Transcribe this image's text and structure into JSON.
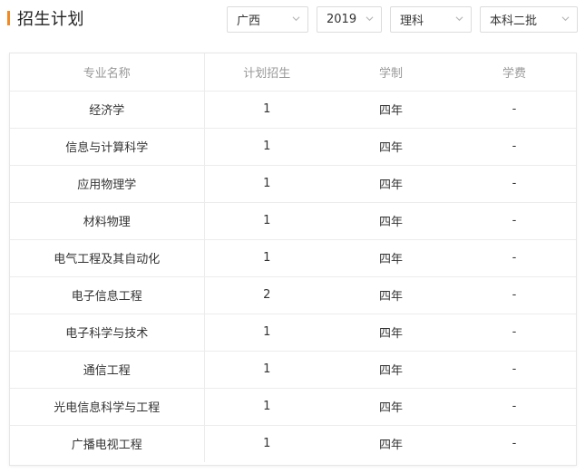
{
  "header": {
    "title": "招生计划"
  },
  "filters": {
    "province": "广西",
    "year": "2019",
    "subject": "理科",
    "batch": "本科二批"
  },
  "colors": {
    "accent": "#f08a24",
    "header_text": "#999999",
    "border": "#ececec"
  },
  "table": {
    "columns": [
      "专业名称",
      "计划招生",
      "学制",
      "学费"
    ],
    "rows": [
      [
        "经济学",
        "1",
        "四年",
        "-"
      ],
      [
        "信息与计算科学",
        "1",
        "四年",
        "-"
      ],
      [
        "应用物理学",
        "1",
        "四年",
        "-"
      ],
      [
        "材料物理",
        "1",
        "四年",
        "-"
      ],
      [
        "电气工程及其自动化",
        "1",
        "四年",
        "-"
      ],
      [
        "电子信息工程",
        "2",
        "四年",
        "-"
      ],
      [
        "电子科学与技术",
        "1",
        "四年",
        "-"
      ],
      [
        "通信工程",
        "1",
        "四年",
        "-"
      ],
      [
        "光电信息科学与工程",
        "1",
        "四年",
        "-"
      ],
      [
        "广播电视工程",
        "1",
        "四年",
        "-"
      ]
    ]
  }
}
